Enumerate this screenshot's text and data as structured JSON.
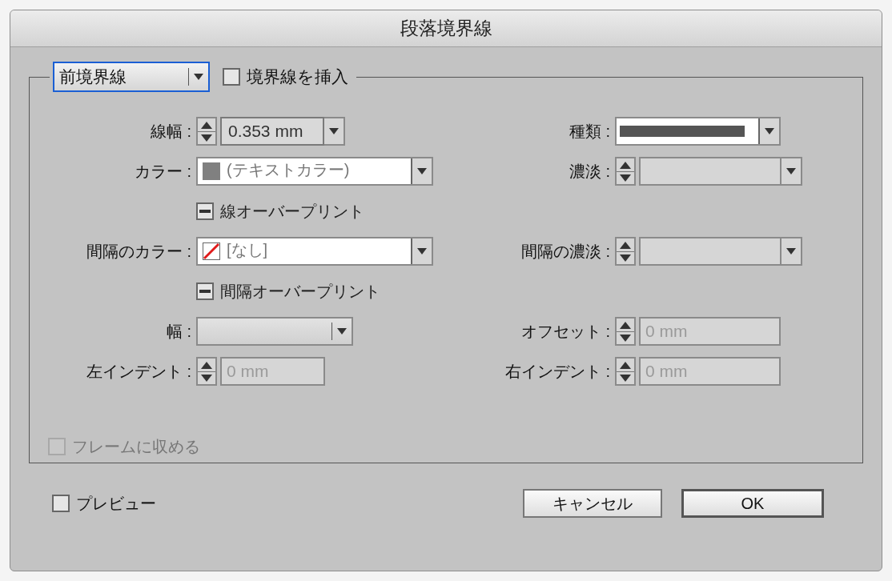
{
  "window": {
    "title": "段落境界線"
  },
  "rule_select": {
    "value": "前境界線",
    "focused": true
  },
  "insert_rule": {
    "label": "境界線を挿入",
    "checked": false
  },
  "rows": [
    {
      "left": {
        "kind": "stepper_combo",
        "label": "線幅 :",
        "value": "0.353 mm",
        "disabled": false
      },
      "right": {
        "kind": "stroke_dropdown",
        "label": "種類 :"
      }
    },
    {
      "left": {
        "kind": "color_dropdown",
        "label": "カラー :",
        "value": "(テキストカラー)",
        "no_color": false
      },
      "right": {
        "kind": "stepper_combo",
        "label": "濃淡 :",
        "disabled": true
      }
    },
    {
      "left": {
        "kind": "checkbox",
        "label": "線オーバープリント",
        "mixed": true
      }
    },
    {
      "left": {
        "kind": "color_dropdown",
        "label": "間隔のカラー :",
        "value": "[なし]",
        "no_color": true
      },
      "right": {
        "kind": "stepper_combo",
        "label": "間隔の濃淡 :",
        "disabled": true
      }
    },
    {
      "left": {
        "kind": "checkbox",
        "label": "間隔オーバープリント",
        "mixed": true
      }
    },
    {
      "left": {
        "kind": "dropdown",
        "label": "幅 :"
      },
      "right": {
        "kind": "stepper",
        "label": "オフセット :",
        "value": "0 mm",
        "disabled": true
      }
    },
    {
      "left": {
        "kind": "stepper",
        "label": "左インデント :",
        "value": "0 mm",
        "disabled": true
      },
      "right": {
        "kind": "stepper",
        "label": "右インデント :",
        "value": "0 mm",
        "disabled": true
      }
    }
  ],
  "fit_to_frame": {
    "label": "フレームに収める",
    "checked": false,
    "disabled": true
  },
  "preview": {
    "label": "プレビュー",
    "checked": false
  },
  "buttons": [
    {
      "label": "キャンセル",
      "default": false
    },
    {
      "label": "OK",
      "default": true
    }
  ]
}
